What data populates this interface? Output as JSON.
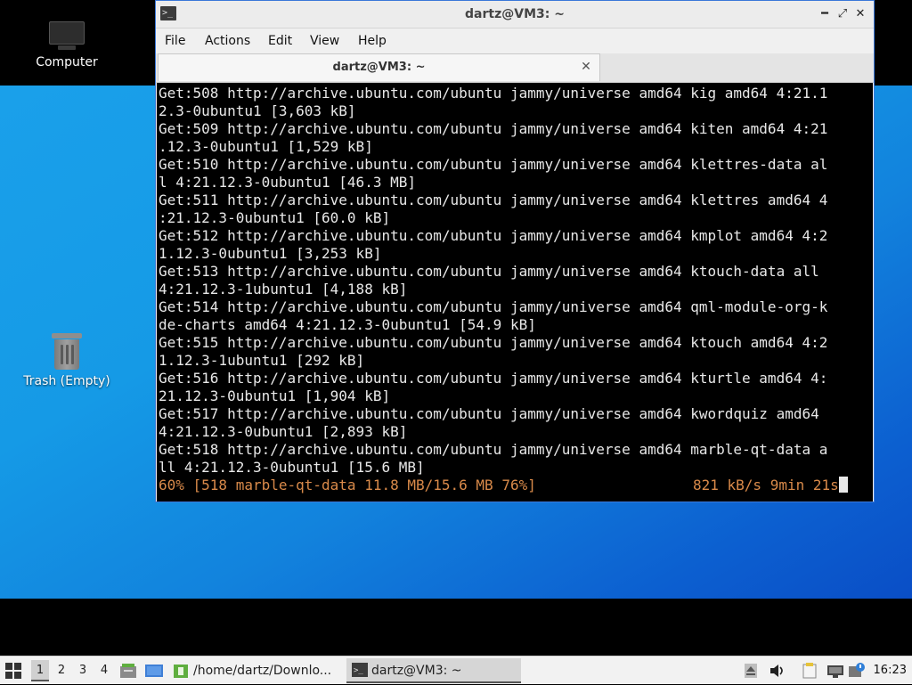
{
  "desktop": {
    "icons": [
      {
        "label": "Computer"
      },
      {
        "label": "Trash (Empty)"
      }
    ]
  },
  "window": {
    "title": "dartz@VM3: ~",
    "controls": {
      "minimize": "━",
      "maximize": "⤢",
      "close": "✕"
    },
    "menu": [
      "File",
      "Actions",
      "Edit",
      "View",
      "Help"
    ],
    "tab": {
      "label": "dartz@VM3: ~",
      "close": "✕"
    }
  },
  "terminal": {
    "lines": [
      "Get:508 http://archive.ubuntu.com/ubuntu jammy/universe amd64 kig amd64 4:21.1",
      "2.3-0ubuntu1 [3,603 kB]",
      "Get:509 http://archive.ubuntu.com/ubuntu jammy/universe amd64 kiten amd64 4:21",
      ".12.3-0ubuntu1 [1,529 kB]",
      "Get:510 http://archive.ubuntu.com/ubuntu jammy/universe amd64 klettres-data al",
      "l 4:21.12.3-0ubuntu1 [46.3 MB]",
      "Get:511 http://archive.ubuntu.com/ubuntu jammy/universe amd64 klettres amd64 4",
      ":21.12.3-0ubuntu1 [60.0 kB]",
      "Get:512 http://archive.ubuntu.com/ubuntu jammy/universe amd64 kmplot amd64 4:2",
      "1.12.3-0ubuntu1 [3,253 kB]",
      "Get:513 http://archive.ubuntu.com/ubuntu jammy/universe amd64 ktouch-data all",
      "4:21.12.3-1ubuntu1 [4,188 kB]",
      "Get:514 http://archive.ubuntu.com/ubuntu jammy/universe amd64 qml-module-org-k",
      "de-charts amd64 4:21.12.3-0ubuntu1 [54.9 kB]",
      "Get:515 http://archive.ubuntu.com/ubuntu jammy/universe amd64 ktouch amd64 4:2",
      "1.12.3-1ubuntu1 [292 kB]",
      "Get:516 http://archive.ubuntu.com/ubuntu jammy/universe amd64 kturtle amd64 4:",
      "21.12.3-0ubuntu1 [1,904 kB]",
      "Get:517 http://archive.ubuntu.com/ubuntu jammy/universe amd64 kwordquiz amd64",
      "4:21.12.3-0ubuntu1 [2,893 kB]",
      "Get:518 http://archive.ubuntu.com/ubuntu jammy/universe amd64 marble-qt-data a",
      "ll 4:21.12.3-0ubuntu1 [15.6 MB]"
    ],
    "status_left": "60% [518 marble-qt-data 11.8 MB/15.6 MB 76%]",
    "status_right": "821 kB/s 9min 21s",
    "status_color": "#d98a4a"
  },
  "taskbar": {
    "workspaces": [
      "1",
      "2",
      "3",
      "4"
    ],
    "active_workspace": "1",
    "tasks": [
      {
        "label": "/home/dartz/Downlo..."
      },
      {
        "label": "dartz@VM3: ~"
      }
    ],
    "clock": "16:23"
  }
}
